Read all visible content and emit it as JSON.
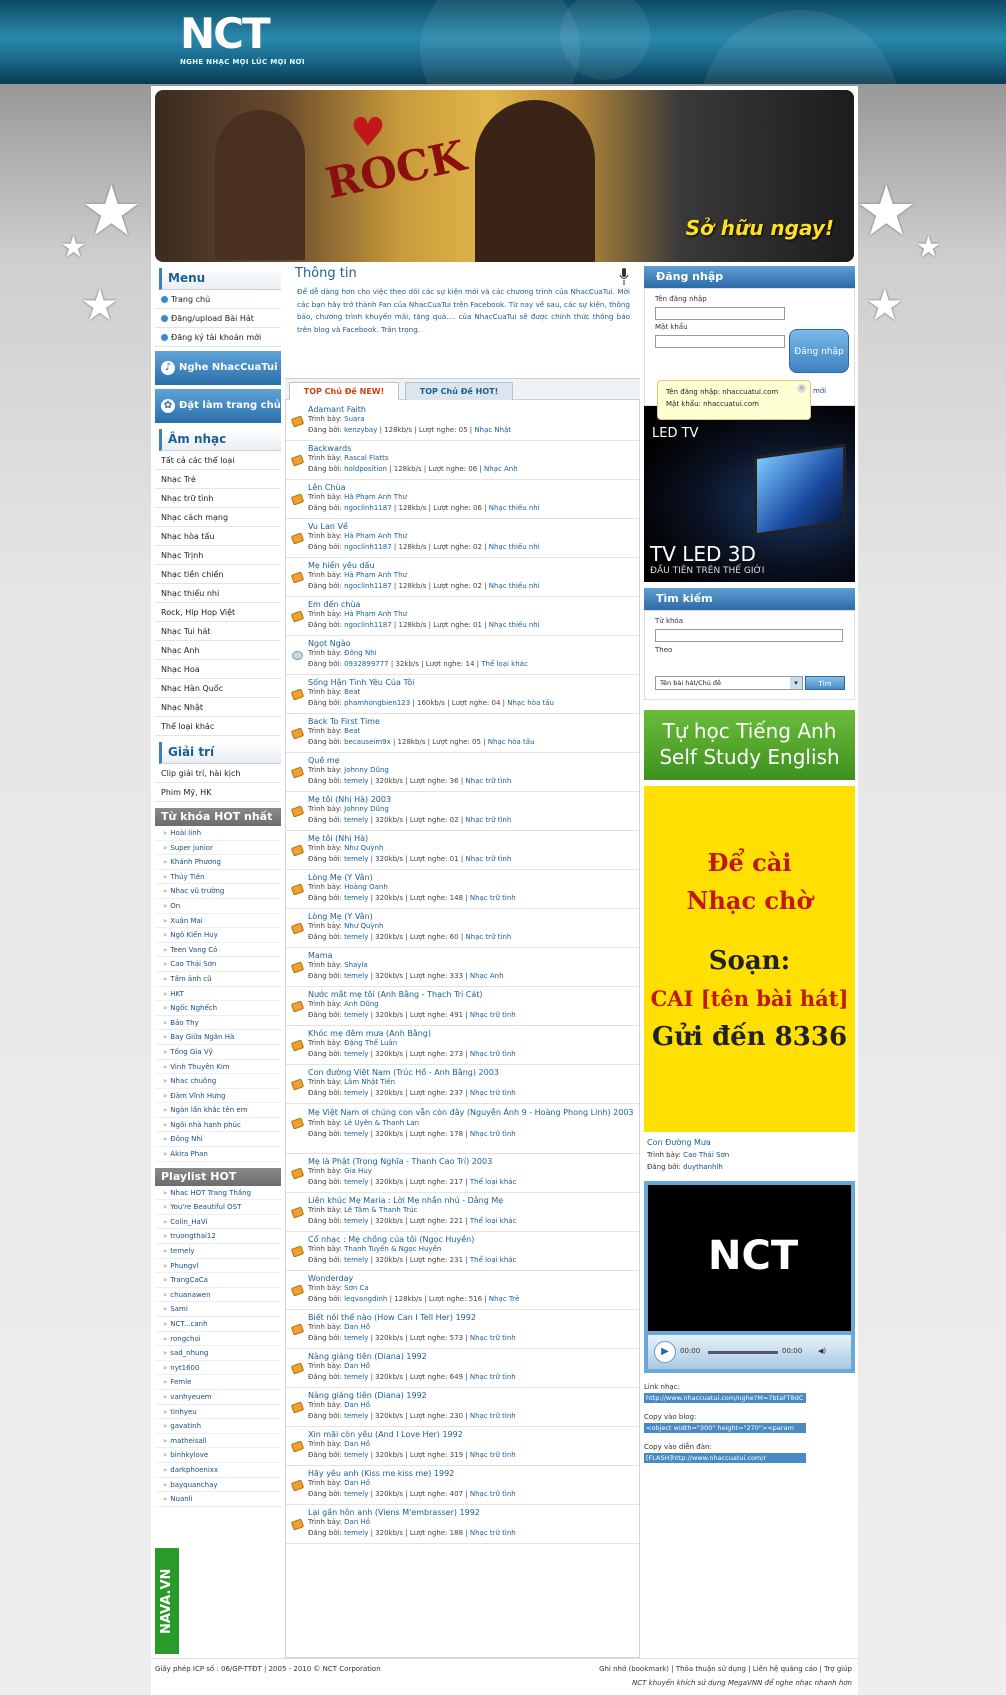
{
  "header": {
    "logo": "NCT",
    "tagline": "NGHE NHẠC MỌI LÚC MỌI NƠI"
  },
  "banner": {
    "text_rock": "ROCK",
    "cta": "Sở hữu ngay!"
  },
  "left": {
    "menu_title": "Menu",
    "menu": [
      "Trang chủ",
      "Đăng/upload Bài Hát",
      "Đăng ký tài khoản mới"
    ],
    "btn_listen": "Nghe NhacCuaTui",
    "btn_home": "Đặt làm trang chủ",
    "music_title": "Âm nhạc",
    "music": [
      "Tất cả các thể loại",
      "Nhạc Trẻ",
      "Nhạc trữ tình",
      "Nhạc cách mạng",
      "Nhạc hòa tấu",
      "Nhạc Trịnh",
      "Nhạc tiền chiến",
      "Nhạc thiếu nhi",
      "Rock, Hip Hop Việt",
      "Nhạc Tui hát",
      "Nhạc Anh",
      "Nhạc Hoa",
      "Nhạc Hàn Quốc",
      "Nhạc Nhật",
      "Thể loại khác"
    ],
    "ent_title": "Giải trí",
    "ent": [
      "Clip giải trí, hài kịch",
      "Phim Mỹ, HK"
    ],
    "hot_title": "Từ khóa HOT nhất",
    "hot": [
      "Hoài linh",
      "Super junior",
      "Khánh Phương",
      "Thủy Tiên",
      "Nhac vũ trường",
      "On",
      "Xuân Mai",
      "Ngô Kiến Huy",
      "Teen Vang Cỏ",
      "Cao Thái Sơn",
      "Tấm ảnh cũ",
      "HKT",
      "Ngốc Nghếch",
      "Bảo Thy",
      "Bay Giữa Ngân Hà",
      "Tống Gia Vỹ",
      "Vinh Thuyên Kim",
      "Nhac chuông",
      "Đàm Vĩnh Hưng",
      "Ngàn lần khắc tên em",
      "Ngôi nhà hạnh phúc",
      "Đông Nhi",
      "Akira Phan"
    ],
    "playlist_title": "Playlist HOT",
    "playlist": [
      "Nhac HOT Trang Thắng",
      "You're Beautiful OST",
      "Colin_HaVi",
      "truongthai12",
      "temely",
      "Phungvl",
      "TrangCaCa",
      "chuanawen",
      "Sami",
      "NCT...canh",
      "rongchoi",
      "sad_nhung",
      "nyt1600",
      "Femle",
      "vanhyeuem",
      "tinhyeu",
      "gavatinh",
      "matheisall",
      "binhkylove",
      "darkphoenixx",
      "bayquanchay",
      "Nuanli"
    ],
    "nava": "NAVA.VN"
  },
  "center": {
    "title": "Thông tin",
    "intro": "Để dễ dàng hơn cho việc theo dõi các sự kiện mới và các chương trình của NhacCuaTui. Mời các bạn hãy trở thành Fan của NhacCuaTui trên Facebook. Từ nay về sau, các sự kiện, thông báo, chương trình khuyến mãi, tặng quà.... của NhacCuaTui sẽ được chính thức thông báo trên blog và Facebook. Trân trọng.",
    "tab_new": "TOP Chủ Đề NEW!",
    "tab_hot": "TOP Chủ Đề HOT!",
    "lbl_artist": "Trình bày:",
    "lbl_poster": "Đăng bởi:",
    "lbl_views": "Lượt nghe:",
    "songs": [
      {
        "title": "Adamant Faith",
        "artist": "Suara",
        "poster": "kenzybay",
        "kbps": "128kb/s",
        "views": "05",
        "genre": "Nhạc Nhật"
      },
      {
        "title": "Backwards",
        "artist": "Rascal Flatts",
        "poster": "holdposition",
        "kbps": "128kb/s",
        "views": "06",
        "genre": "Nhạc Anh"
      },
      {
        "title": "Lên Chùa",
        "artist": "Hà Phạm Anh Thư",
        "poster": "ngoclinh1187",
        "kbps": "128kb/s",
        "views": "06",
        "genre": "Nhạc thiếu nhi"
      },
      {
        "title": "Vu Lan Về",
        "artist": "Hà Phạm Anh Thư",
        "poster": "ngoclinh1187",
        "kbps": "128kb/s",
        "views": "02",
        "genre": "Nhạc thiếu nhi"
      },
      {
        "title": "Mẹ hiền yêu dấu",
        "artist": "Hà Phạm Anh Thư",
        "poster": "ngoclinh1187",
        "kbps": "128kb/s",
        "views": "02",
        "genre": "Nhạc thiếu nhi"
      },
      {
        "title": "Em đến chùa",
        "artist": "Hà Phạm Anh Thư",
        "poster": "ngoclinh1187",
        "kbps": "128kb/s",
        "views": "01",
        "genre": "Nhạc thiếu nhi"
      },
      {
        "title": "Ngọt Ngào",
        "artist": "Đông Nhi",
        "poster": "0932899777",
        "kbps": "32kb/s",
        "views": "14",
        "genre": "Thể loại khác",
        "globe": true
      },
      {
        "title": "Sống Hận Tình Yêu Của Tôi",
        "artist": "Beat",
        "poster": "phamhongbien123",
        "kbps": "160kb/s",
        "views": "04",
        "genre": "Nhạc hòa tấu"
      },
      {
        "title": "Back To First Time",
        "artist": "Beat",
        "poster": "becauseim9x",
        "kbps": "128kb/s",
        "views": "05",
        "genre": "Nhạc hòa tấu"
      },
      {
        "title": "Quê mẹ",
        "artist": "Johnny Dũng",
        "poster": "temely",
        "kbps": "320kb/s",
        "views": "36",
        "genre": "Nhạc trữ tình"
      },
      {
        "title": "Mẹ tôi (Nhị Hà) 2003",
        "artist": "Johnny Dũng",
        "poster": "temely",
        "kbps": "320kb/s",
        "views": "02",
        "genre": "Nhạc trữ tình"
      },
      {
        "title": "Mẹ tôi (Nhị Hà)",
        "artist": "Như Quỳnh",
        "poster": "temely",
        "kbps": "320kb/s",
        "views": "01",
        "genre": "Nhạc trữ tình"
      },
      {
        "title": "Lòng Mẹ (Y Vân)",
        "artist": "Hoàng Oanh",
        "poster": "temely",
        "kbps": "320kb/s",
        "views": "148",
        "genre": "Nhạc trữ tình"
      },
      {
        "title": "Lòng Mẹ (Y Vân)",
        "artist": "Như Quỳnh",
        "poster": "temely",
        "kbps": "320kb/s",
        "views": "60",
        "genre": "Nhạc trữ tình"
      },
      {
        "title": "Mama",
        "artist": "Shayla",
        "poster": "temely",
        "kbps": "320kb/s",
        "views": "333",
        "genre": "Nhạc Anh"
      },
      {
        "title": "Nước mắt mẹ tôi (Anh Bằng - Thạch Trí Cát)",
        "artist": "Anh Dũng",
        "poster": "temely",
        "kbps": "320kb/s",
        "views": "491",
        "genre": "Nhạc trữ tình"
      },
      {
        "title": "Khóc mẹ đêm mưa (Anh Bằng)",
        "artist": "Đặng Thế Luân",
        "poster": "temely",
        "kbps": "320kb/s",
        "views": "273",
        "genre": "Nhạc trữ tình"
      },
      {
        "title": "Con đường Việt Nam (Trúc Hồ - Anh Bằng) 2003",
        "artist": "Lâm Nhật Tiến",
        "poster": "temely",
        "kbps": "320kb/s",
        "views": "237",
        "genre": "Nhạc trữ tình"
      },
      {
        "title": "Mẹ Việt Nam ơi chúng con vẫn còn đây (Nguyễn Ánh 9 - Hoàng Phong Linh) 2003",
        "artist": "Lê Uyên & Thanh Lan",
        "poster": "temely",
        "kbps": "320kb/s",
        "views": "178",
        "genre": "Nhạc trữ tình",
        "tall": true
      },
      {
        "title": "Mẹ là Phật (Trọng Nghĩa - Thanh Cao Trí) 2003",
        "artist": "Gia Huy",
        "poster": "temely",
        "kbps": "320kb/s",
        "views": "217",
        "genre": "Thể loại khác"
      },
      {
        "title": "Liên khúc Mẹ Maria : Lời Mẹ nhắn nhủ - Dâng Mẹ",
        "artist": "Lê Tâm & Thanh Trúc",
        "poster": "temely",
        "kbps": "320kb/s",
        "views": "221",
        "genre": "Thể loại khác"
      },
      {
        "title": "Cổ nhạc : Mẹ chồng của tôi (Ngọc Huyền)",
        "artist": "Thanh Tuyền & Ngọc Huyền",
        "poster": "temely",
        "kbps": "320kb/s",
        "views": "231",
        "genre": "Thể loại khác"
      },
      {
        "title": "Wonderday",
        "artist": "Sơn Ca",
        "poster": "leqvangdinh",
        "kbps": "128kb/s",
        "views": "516",
        "genre": "Nhạc Trẻ"
      },
      {
        "title": "Biết nói thế nào (How Can I Tell Her) 1992",
        "artist": "Dan Hồ",
        "poster": "temely",
        "kbps": "320kb/s",
        "views": "573",
        "genre": "Nhạc trữ tình"
      },
      {
        "title": "Nàng giáng tiên (Diana) 1992",
        "artist": "Dan Hồ",
        "poster": "temely",
        "kbps": "320kb/s",
        "views": "649",
        "genre": "Nhạc trữ tình"
      },
      {
        "title": "Nàng giáng tiên (Diana) 1992",
        "artist": "Dan Hồ",
        "poster": "temely",
        "kbps": "320kb/s",
        "views": "230",
        "genre": "Nhạc trữ tình"
      },
      {
        "title": "Xin mãi còn yêu (And I Love Her) 1992",
        "artist": "Dan Hồ",
        "poster": "temely",
        "kbps": "320kb/s",
        "views": "319",
        "genre": "Nhạc trữ tình"
      },
      {
        "title": "Hãy yêu anh (Kiss me kiss me) 1992",
        "artist": "Dan Hồ",
        "poster": "temely",
        "kbps": "320kb/s",
        "views": "407",
        "genre": "Nhạc trữ tình"
      },
      {
        "title": "Lại gần hôn anh (Viens M'embrasser) 1992",
        "artist": "Dan Hồ",
        "poster": "temely",
        "kbps": "320kb/s",
        "views": "188",
        "genre": "Nhạc trữ tình"
      }
    ]
  },
  "right": {
    "login_title": "Đăng nhập",
    "lbl_user": "Tên đăng nhập",
    "lbl_pass": "Mật khẩu",
    "btn_login": "Đăng nhập",
    "tip_user": "Tên đăng nhập: nhaccuatui.com",
    "tip_pass": "Mật khẩu: nhaccuatui.com",
    "forgot": "mới",
    "led_logo": "LED TV",
    "led_title": "TV LED 3D",
    "led_sub": "ĐẦU TIÊN TRÊN THẾ GIỚI",
    "search_title": "Tìm kiếm",
    "lbl_kw": "Từ khóa",
    "lbl_by": "Theo",
    "select_value": "Tên bài hát/Chủ đề",
    "btn_find": "Tìm",
    "eng_1": "Tự học Tiếng Anh",
    "eng_2": "Self Study English",
    "ring_1": "Để cài",
    "ring_2": "Nhạc chờ",
    "ring_3": "Soạn:",
    "ring_4": "CAI [tên bài hát]",
    "ring_5": "Gửi đến 8336",
    "now_title": "Con Đường Mưa",
    "now_artist_lbl": "Trình bày:",
    "now_artist": "Cao Thái Sơn",
    "now_poster_lbl": "Đăng bởi:",
    "now_poster": "duythanhlh",
    "player_logo": "NCT",
    "time1": "00:00",
    "time2": "00:00",
    "link_lbl": "Link nhạc:",
    "link_val": "http://www.nhaccuatui.com/nghe?M=7btaFT8dC",
    "blog_lbl": "Copy vào blog:",
    "blog_val": "<object width=\"300\" height=\"270\"><param",
    "forum_lbl": "Copy vào diễn đàn:",
    "forum_val": "[FLASH]http://www.nhaccuatui.com/r"
  },
  "footer": {
    "left": "Giấy phép ICP số : 06/GP-TTĐT | 2005 - 2010 © NCT Corporation",
    "links": "Ghi nhớ (bookmark) | Thỏa thuận sử dụng | Liên hệ quảng cáo | Trợ giúp",
    "note": "NCT khuyến khích sử dụng MegaVNN để nghe nhạc nhanh hơn"
  }
}
